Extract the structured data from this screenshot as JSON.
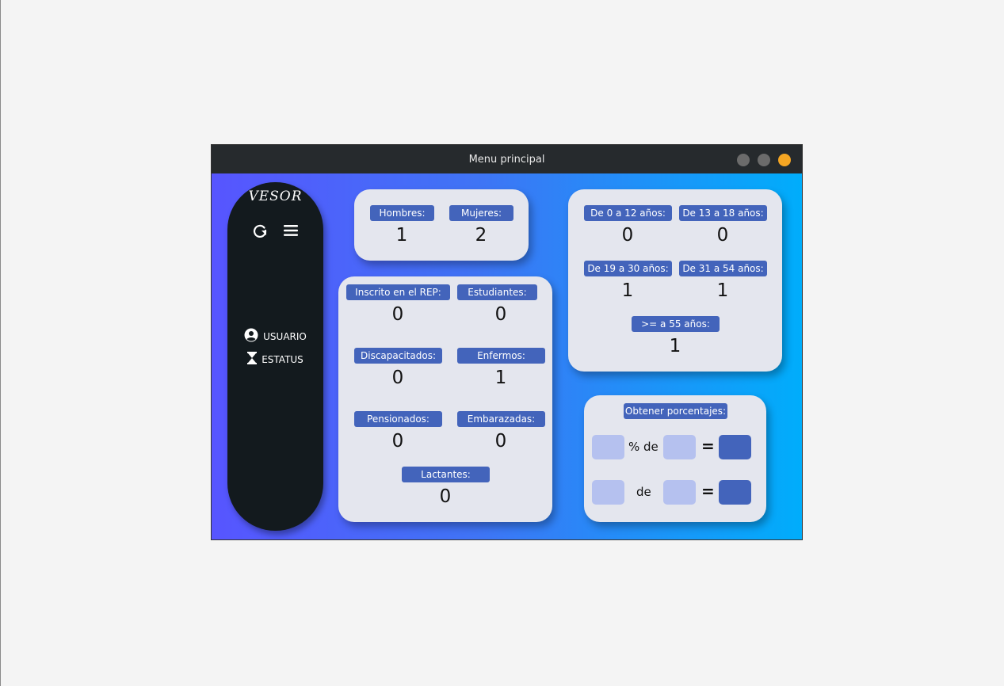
{
  "window": {
    "title": "Menu principal"
  },
  "sidebar": {
    "logo": "VESOR",
    "refresh_icon": "refresh-icon",
    "menu_icon": "hamburger-menu-icon",
    "items": [
      {
        "label": "USUARIO",
        "icon": "user-circle-icon"
      },
      {
        "label": "ESTATUS",
        "icon": "hourglass-icon"
      }
    ]
  },
  "gender": {
    "hombres_label": "Hombres:",
    "hombres_value": "1",
    "mujeres_label": "Mujeres:",
    "mujeres_value": "2"
  },
  "stats": {
    "rep_label": "Inscrito en el REP:",
    "rep_value": "0",
    "estudiantes_label": "Estudiantes:",
    "estudiantes_value": "0",
    "discapacitados_label": "Discapacitados:",
    "discapacitados_value": "0",
    "enfermos_label": "Enfermos:",
    "enfermos_value": "1",
    "pensionados_label": "Pensionados:",
    "pensionados_value": "0",
    "embarazadas_label": "Embarazadas:",
    "embarazadas_value": "0",
    "lactantes_label": "Lactantes:",
    "lactantes_value": "0"
  },
  "ages": {
    "a0_12_label": "De 0 a 12 años:",
    "a0_12_value": "0",
    "a13_18_label": "De 13 a 18 años:",
    "a13_18_value": "0",
    "a19_30_label": "De 19 a 30 años:",
    "a19_30_value": "1",
    "a31_54_label": "De 31 a 54 años:",
    "a31_54_value": "1",
    "a55_label": ">= a 55 años:",
    "a55_value": "1"
  },
  "percent": {
    "title": "Obtener porcentajes:",
    "row1_text": "% de",
    "row2_text": "de",
    "equals": "="
  },
  "colors": {
    "accent": "#4364bb",
    "input_light": "#b5c1ef",
    "card_bg": "#e4e6ee",
    "sidebar_bg": "#131a1e",
    "gradient_start": "#5755ff",
    "gradient_end": "#00adfb"
  }
}
